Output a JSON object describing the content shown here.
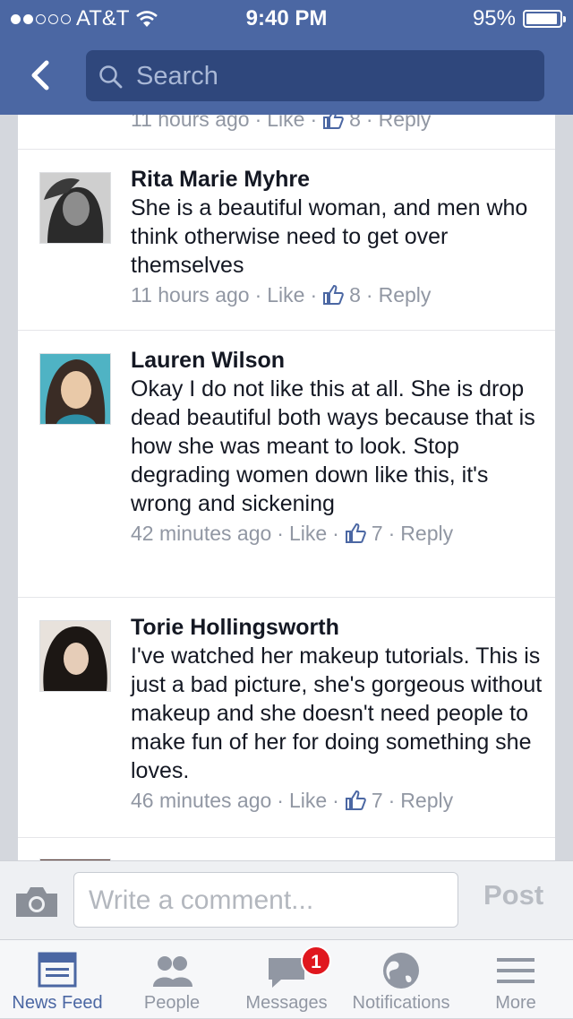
{
  "status": {
    "carrier": "AT&T",
    "time": "9:40 PM",
    "battery": "95%",
    "signal_bars": 2
  },
  "nav": {
    "search_placeholder": "Search"
  },
  "comments": [
    {
      "name": "",
      "text": "",
      "time": "11 hours ago",
      "like": "Like",
      "likes": "8",
      "reply": "Reply"
    },
    {
      "name": "Rita Marie Myhre",
      "text": "She is a beautiful woman, and men who think otherwise need to get over themselves",
      "time": "11 hours ago",
      "like": "Like",
      "likes": "8",
      "reply": "Reply"
    },
    {
      "name": "Lauren Wilson",
      "text": "Okay I do not like this at all. She is drop dead beautiful both ways because that is how she was meant to look. Stop degrading women down like this, it's wrong and sickening",
      "time": "42 minutes ago",
      "like": "Like",
      "likes": "7",
      "reply": "Reply"
    },
    {
      "name": "Torie Hollingsworth",
      "text": "I've watched her makeup tutorials. This is just a bad picture, she's gorgeous without makeup and she doesn't need people to make fun of her for doing something she loves.",
      "time": "46 minutes ago",
      "like": "Like",
      "likes": "7",
      "reply": "Reply"
    }
  ],
  "composer": {
    "placeholder": "Write a comment...",
    "post_label": "Post"
  },
  "tabs": [
    {
      "label": "News Feed",
      "icon": "news-feed-icon",
      "active": true
    },
    {
      "label": "People",
      "icon": "people-icon"
    },
    {
      "label": "Messages",
      "icon": "messages-icon",
      "badge": "1"
    },
    {
      "label": "Notifications",
      "icon": "globe-icon"
    },
    {
      "label": "More",
      "icon": "menu-icon"
    }
  ],
  "colors": {
    "header": "#4b67a3",
    "search_bg": "#2f477c",
    "meta_text": "#9197a3",
    "badge": "#e0171e"
  }
}
